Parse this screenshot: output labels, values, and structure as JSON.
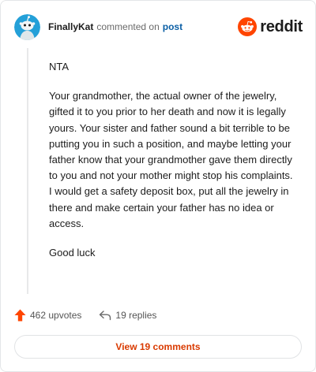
{
  "comment": {
    "username": "FinallyKat",
    "action_text": "commented on",
    "link_text": "post",
    "paragraphs": [
      "NTA",
      "Your grandmother, the actual owner of the jewelry, gifted it to you prior to her death and now it is legally yours. Your sister and father sound a bit terrible to be putting you in such a position, and maybe letting your father know that your grandmother gave them directly to you and not your mother might stop his complaints. I would get a safety deposit box, put all the jewelry in there and make certain your father has no idea or access.",
      "Good luck"
    ]
  },
  "brand": {
    "wordmark": "reddit",
    "icon": "reddit-snoo-icon",
    "color": "#ff4500"
  },
  "avatar": {
    "icon": "snoo-avatar-icon",
    "color": "#24a0d8"
  },
  "actions": {
    "upvotes_label": "462 upvotes",
    "upvote_icon": "upvote-arrow-icon",
    "upvote_color": "#ff4500",
    "replies_label": "19 replies",
    "reply_icon": "reply-arrow-icon"
  },
  "footer": {
    "view_comments_label": "View 19 comments",
    "accent_color": "#d93a00"
  }
}
